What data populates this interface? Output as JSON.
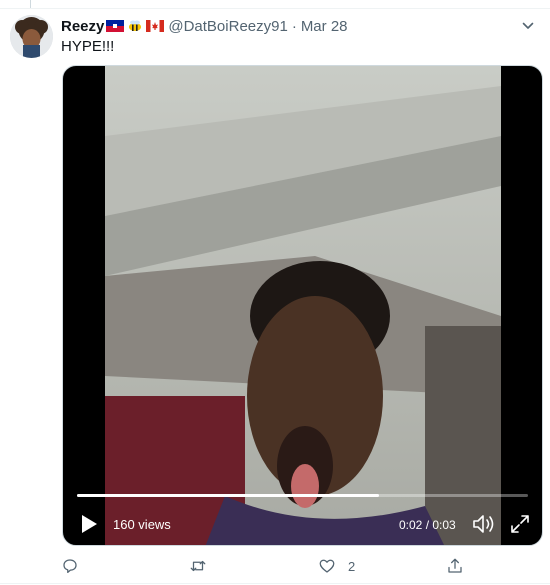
{
  "tweet": {
    "author": {
      "display_name": "Reezy",
      "handle": "@DatBoiReezy91",
      "flags": [
        "haiti-flag",
        "bee-emoji",
        "canada-flag"
      ],
      "avatar": "avatar-afro-cartoon"
    },
    "separator": "·",
    "date": "Mar 28",
    "text": "HYPE!!!"
  },
  "video": {
    "views": "160 views",
    "time": "0:02 / 0:03",
    "progress": 0.67,
    "icons": {
      "play": "play-icon",
      "volume": "volume-icon",
      "fullscreen": "fullscreen-icon"
    }
  },
  "actions": {
    "reply": {
      "icon": "reply-icon",
      "count": ""
    },
    "retweet": {
      "icon": "retweet-icon",
      "count": ""
    },
    "like": {
      "icon": "heart-icon",
      "count": "2"
    },
    "share": {
      "icon": "share-icon",
      "count": ""
    }
  },
  "colors": {
    "secondary_text": "#536471",
    "divider": "#eff3f4",
    "video_bg": "#000000"
  }
}
